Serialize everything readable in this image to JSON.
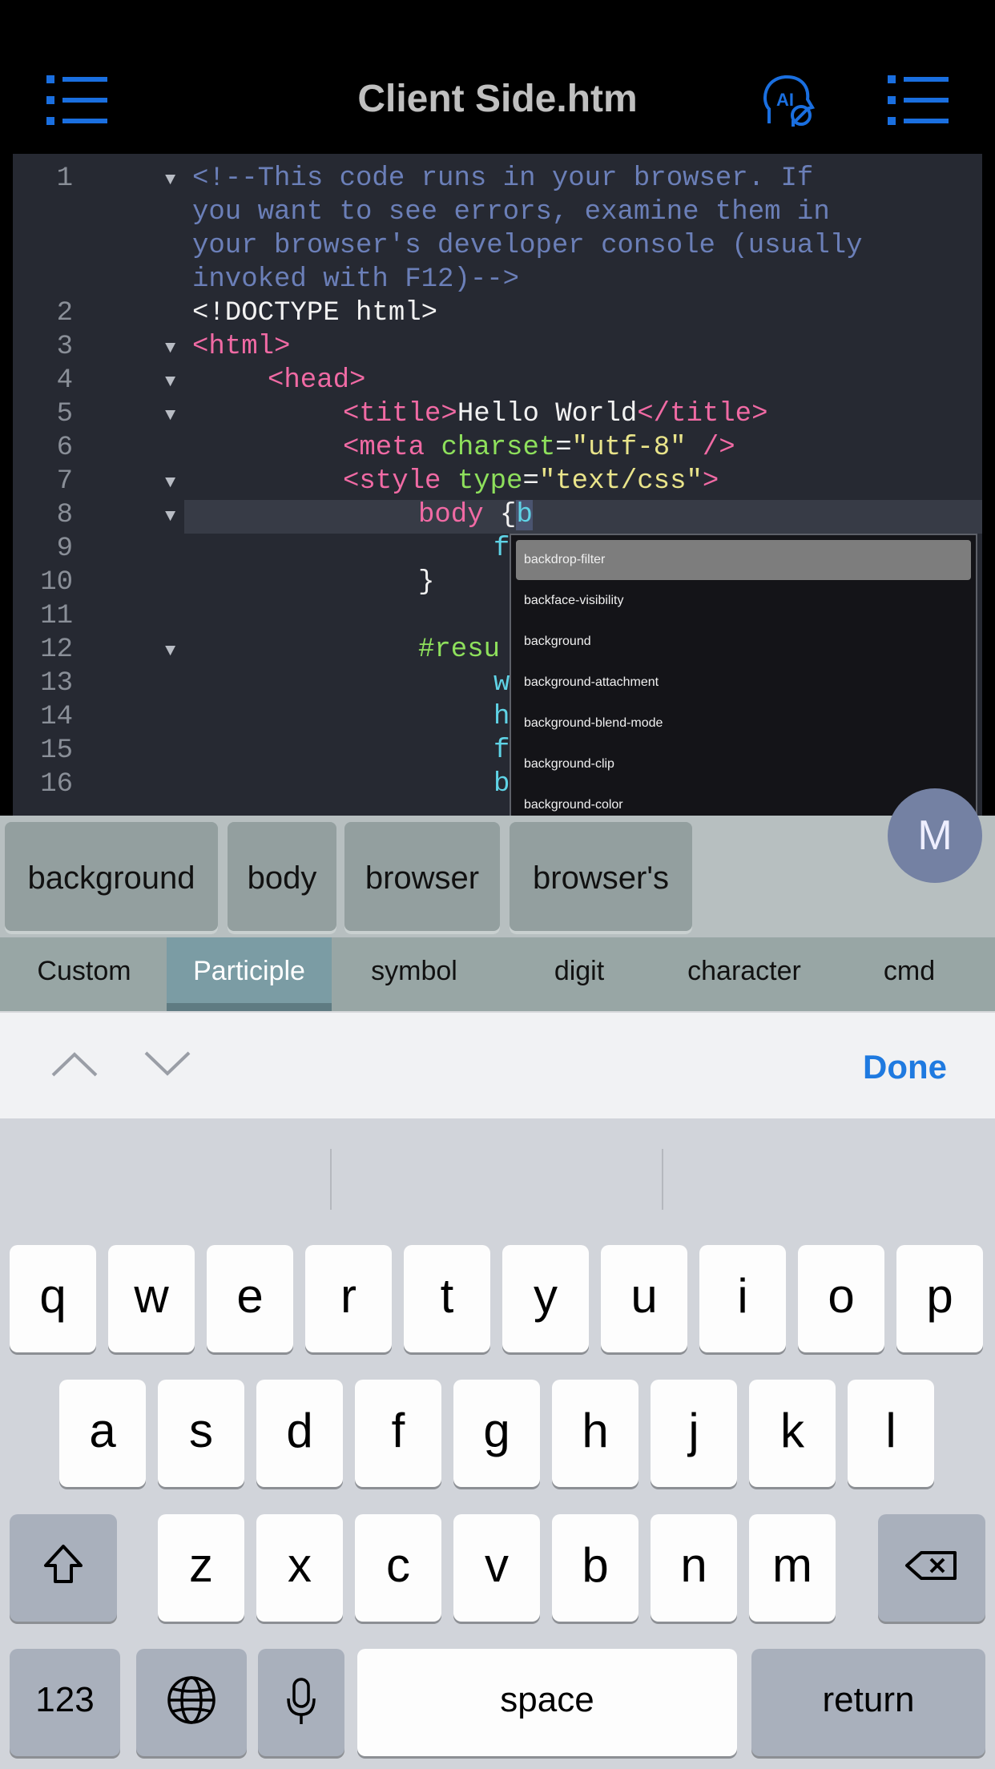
{
  "header": {
    "title": "Client Side.htm",
    "left_icon": "list-icon",
    "ai_icon": "ai-head-icon",
    "right_icon": "list-icon",
    "accent": "#1a6fe0"
  },
  "editor": {
    "line_numbers": [
      "1",
      "2",
      "3",
      "4",
      "5",
      "6",
      "7",
      "8",
      "9",
      "10",
      "11",
      "12",
      "13",
      "14",
      "15",
      "16"
    ],
    "line1": {
      "a": "<!--This code runs in your browser. If",
      "b": "you want to see errors, examine them in",
      "c": "your browser's developer console (usually",
      "d": "invoked with F12)-->"
    },
    "line2": "<!DOCTYPE html>",
    "line3": "<html>",
    "line4": "<head>",
    "line5": {
      "open": "<title>",
      "text": "Hello World",
      "close": "</title>"
    },
    "line6": {
      "open": "<meta",
      "attr": "charset",
      "eq": "=",
      "val": "\"utf-8\"",
      "close": "/>"
    },
    "line7": {
      "open": "<style",
      "attr": "type",
      "eq": "=",
      "val": "\"text/css\"",
      "close": ">"
    },
    "line8": {
      "sel": "body",
      "brace": "{",
      "typed": "b"
    },
    "line9": "f",
    "line10": "}",
    "line12": "#resu",
    "line13": "w",
    "line14": "h",
    "line15": "f",
    "line16": "b"
  },
  "autocomplete": {
    "items": [
      "backdrop-filter",
      "backface-visibility",
      "background",
      "background-attachment",
      "background-blend-mode",
      "background-clip",
      "background-color"
    ]
  },
  "suggestions": {
    "items": [
      "background",
      "body",
      "browser",
      "browser's"
    ],
    "badge": "M"
  },
  "categories": {
    "items": [
      "Custom",
      "Participle",
      "symbol",
      "digit",
      "character",
      "cmd"
    ],
    "active": "Participle"
  },
  "accessory": {
    "up_icon": "chevron-up-icon",
    "down_icon": "chevron-down-icon",
    "done": "Done"
  },
  "keyboard": {
    "row1": [
      "q",
      "w",
      "e",
      "r",
      "t",
      "y",
      "u",
      "i",
      "o",
      "p"
    ],
    "row2": [
      "a",
      "s",
      "d",
      "f",
      "g",
      "h",
      "j",
      "k",
      "l"
    ],
    "row3": [
      "z",
      "x",
      "c",
      "v",
      "b",
      "n",
      "m"
    ],
    "numbers": "123",
    "space": "space",
    "return": "return",
    "shift_icon": "shift-icon",
    "delete_icon": "delete-icon",
    "globe_icon": "globe-icon",
    "mic_icon": "microphone-icon"
  }
}
